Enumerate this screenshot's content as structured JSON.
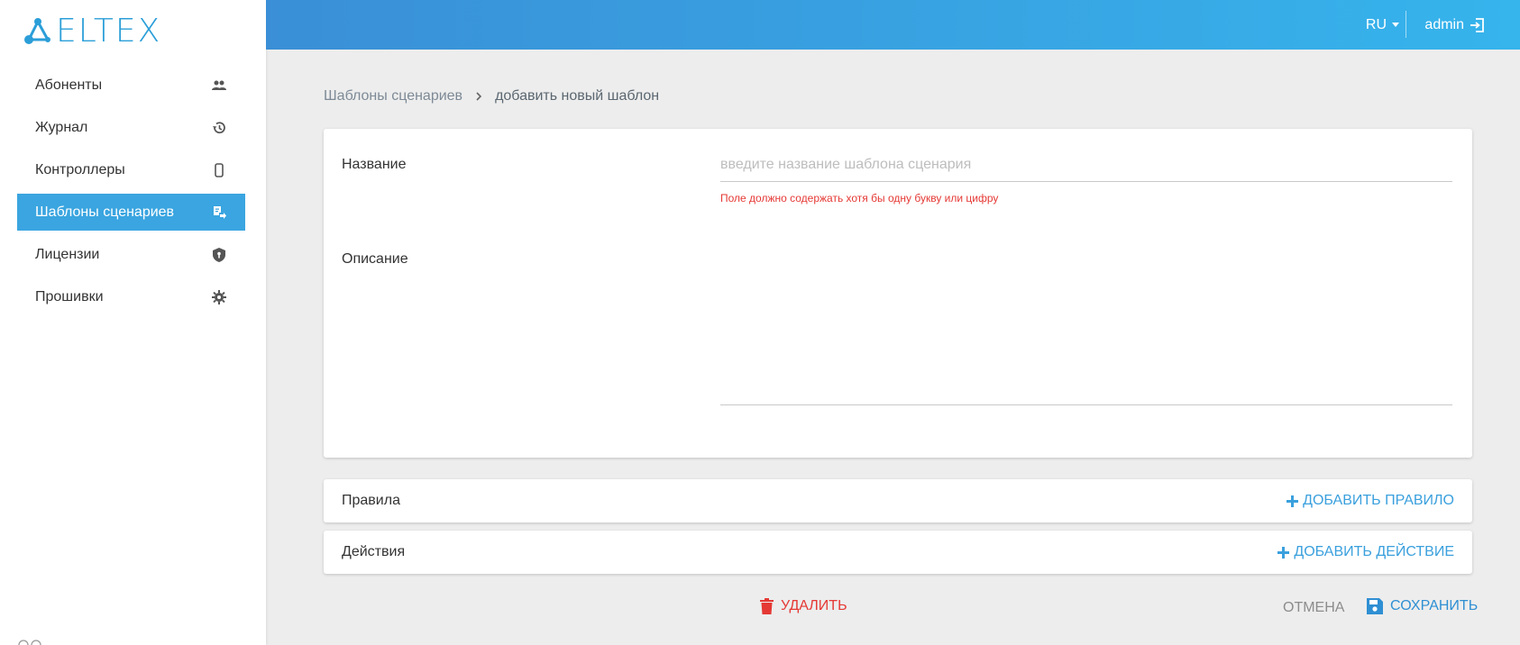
{
  "brand": {
    "logo_text": "ELTEX"
  },
  "header": {
    "language": "RU",
    "username": "admin"
  },
  "sidebar": {
    "items": [
      {
        "label": "Абоненты",
        "icon": "people-icon",
        "active": false
      },
      {
        "label": "Журнал",
        "icon": "history-icon",
        "active": false
      },
      {
        "label": "Контроллеры",
        "icon": "controller-icon",
        "active": false
      },
      {
        "label": "Шаблоны сценариев",
        "icon": "template-icon",
        "active": true
      },
      {
        "label": "Лицензии",
        "icon": "license-icon",
        "active": false
      },
      {
        "label": "Прошивки",
        "icon": "gear-icon",
        "active": false
      }
    ]
  },
  "breadcrumb": {
    "parent": "Шаблоны сценариев",
    "current": "добавить новый шаблон"
  },
  "form": {
    "name_label": "Название",
    "name_value": "",
    "name_placeholder": "введите название шаблона сценария",
    "name_error": "Поле должно содержать хотя бы одну букву или цифру",
    "description_label": "Описание",
    "description_value": ""
  },
  "rules": {
    "title": "Правила",
    "add_label": "ДОБАВИТЬ ПРАВИЛО"
  },
  "actions": {
    "title": "Действия",
    "add_label": "ДОБАВИТЬ ДЕЙСТВИЕ"
  },
  "footer": {
    "delete_label": "УДАЛИТЬ",
    "cancel_label": "ОТМЕНА",
    "save_label": "СОХРАНИТЬ"
  },
  "colors": {
    "accent": "#3aa5e0",
    "header_gradient_start": "#3a8fd6",
    "header_gradient_end": "#36b4ec",
    "error": "#e53935",
    "background": "#ededed"
  }
}
